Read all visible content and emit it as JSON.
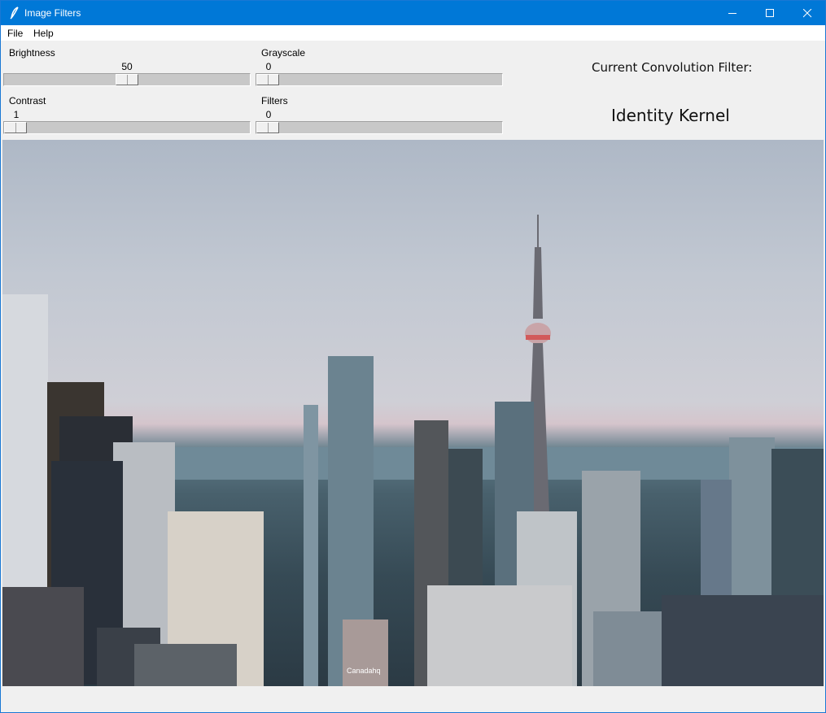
{
  "window": {
    "title": "Image Filters",
    "icon": "feather-icon",
    "controls": [
      "minimize",
      "maximize",
      "close"
    ]
  },
  "menu": {
    "items": [
      {
        "label": "File"
      },
      {
        "label": "Help"
      }
    ]
  },
  "sliders": {
    "brightness": {
      "label": "Brightness",
      "value": "50",
      "fraction": 0.5
    },
    "contrast": {
      "label": "Contrast",
      "value": "1",
      "fraction": 0.0
    },
    "grayscale": {
      "label": "Grayscale",
      "value": "0",
      "fraction": 0.0
    },
    "filters": {
      "label": "Filters",
      "value": "0",
      "fraction": 0.0
    }
  },
  "convolution": {
    "title": "Current Convolution Filter:",
    "value": "Identity Kernel"
  },
  "image": {
    "description": "Toronto city skyline at dusk with CN Tower",
    "sign_text": "Canadahq"
  }
}
